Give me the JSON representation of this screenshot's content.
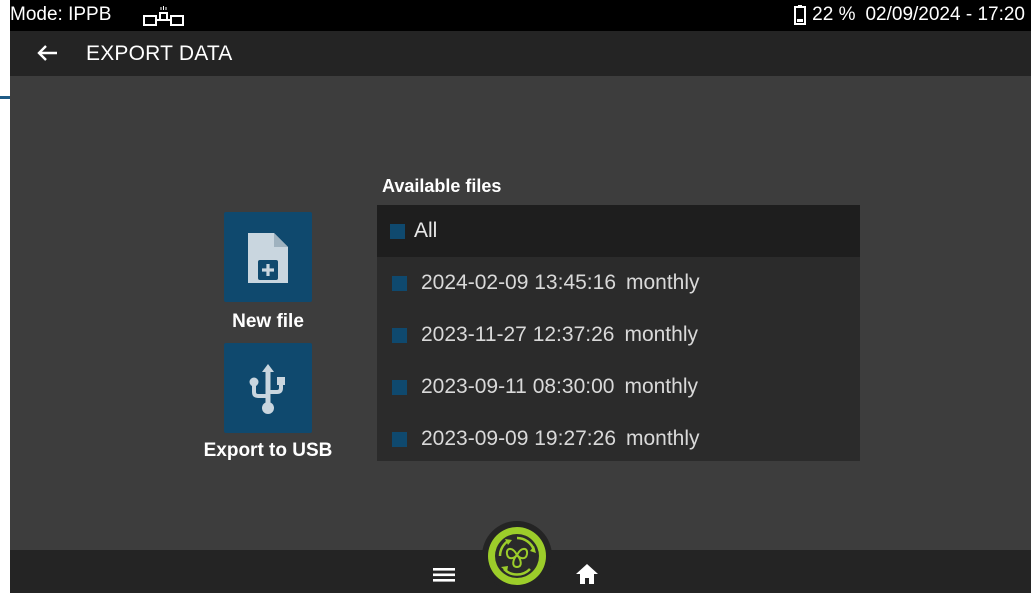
{
  "status_bar": {
    "mode": "Mode: IPPB",
    "battery": "22 %",
    "datetime": "02/09/2024 - 17:20"
  },
  "header": {
    "title": "EXPORT DATA"
  },
  "actions": {
    "new_file_label": "New file",
    "export_usb_label": "Export to USB"
  },
  "files": {
    "heading": "Available files",
    "all_label": "All",
    "items": [
      {
        "date": "2024-02-09 13:45:16",
        "type": "monthly"
      },
      {
        "date": "2023-11-27 12:37:26",
        "type": "monthly"
      },
      {
        "date": "2023-09-11 08:30:00",
        "type": "monthly"
      },
      {
        "date": "2023-09-09 19:27:26",
        "type": "monthly"
      }
    ]
  },
  "colors": {
    "accent": "#0f496e",
    "logo_green": "#9ccd2a",
    "background": "#3d3d3d",
    "bar": "#242424"
  },
  "icons": {
    "device": "device-connector-icon",
    "battery": "battery-icon",
    "back": "arrow-left-icon",
    "new_file": "file-plus-icon",
    "usb": "usb-icon",
    "menu": "hamburger-menu-icon",
    "logo": "recycle-lung-logo-icon",
    "home": "home-icon"
  }
}
